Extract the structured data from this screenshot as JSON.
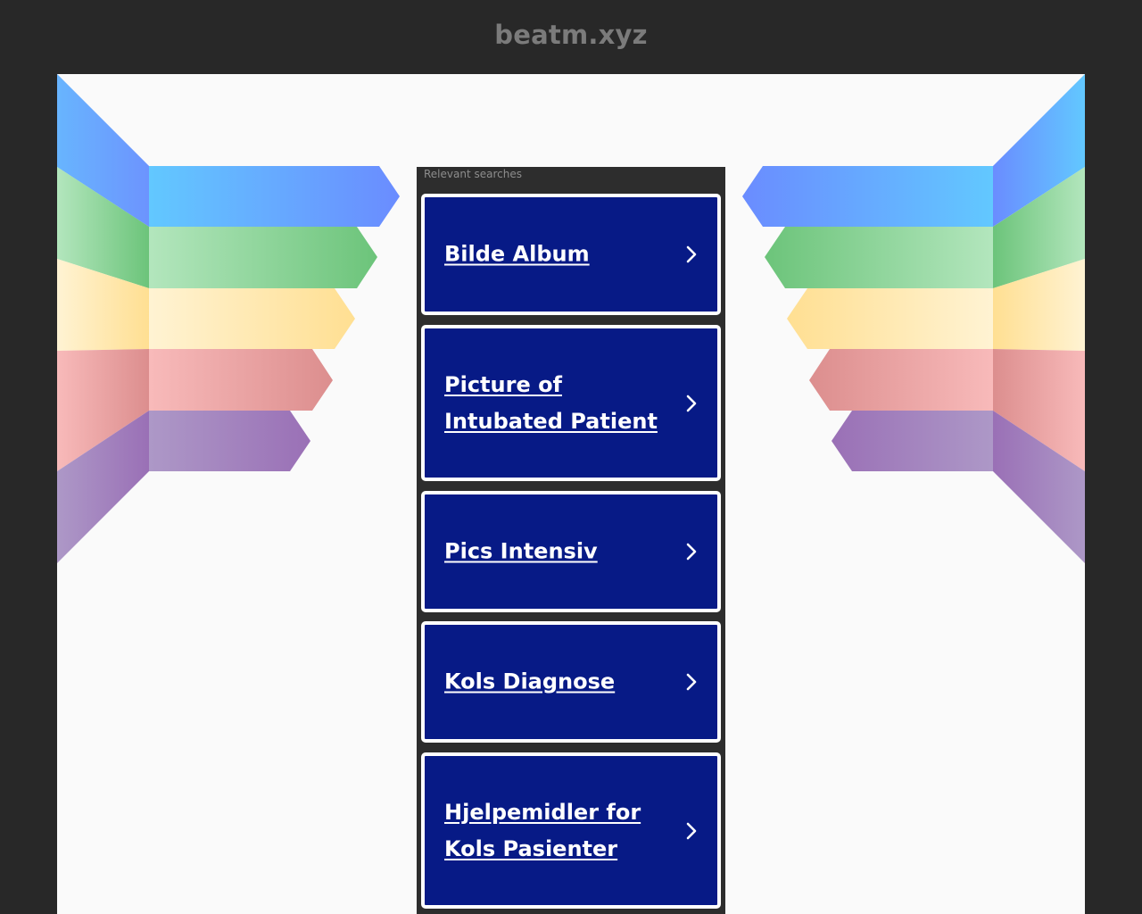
{
  "header": {
    "domain": "beatm.xyz"
  },
  "panel": {
    "heading": "Relevant searches",
    "links": [
      {
        "label": "Bilde Album",
        "icon": "chevron-right-icon"
      },
      {
        "label": "Picture of Intubated Patient",
        "icon": "chevron-right-icon"
      },
      {
        "label": "Pics Intensiv",
        "icon": "chevron-right-icon"
      },
      {
        "label": "Kols Diagnose",
        "icon": "chevron-right-icon"
      },
      {
        "label": "Hjelpemidler for Kols Pasienter",
        "icon": "chevron-right-icon"
      }
    ]
  },
  "colors": {
    "page_background": "#282828",
    "content_background": "#fafafa",
    "panel_background": "#2d2d2d",
    "card_background": "#071a86",
    "card_border": "#ffffff",
    "domain_text": "#7b7b7b",
    "wing_bands": [
      "#6ea8ff",
      "#7ccf8c",
      "#ffe3a0",
      "#f2a7a7",
      "#a585c4"
    ]
  }
}
